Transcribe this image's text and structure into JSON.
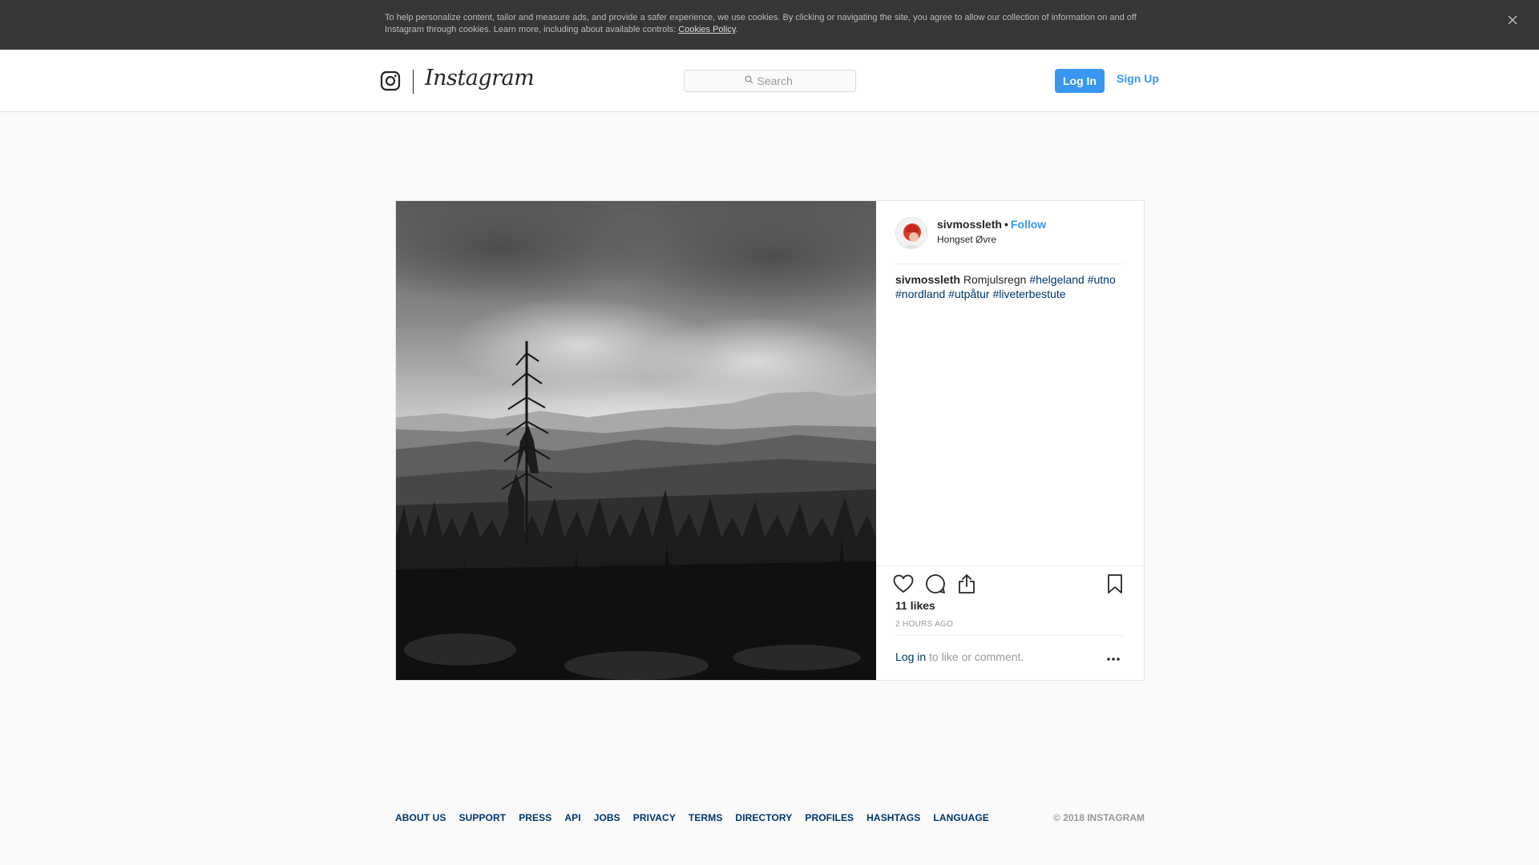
{
  "cookie_banner": {
    "text": "To help personalize content, tailor and measure ads, and provide a safer experience, we use cookies. By clicking or navigating the site, you agree to allow our collection of information on and off Instagram through cookies. Learn more, including about available controls: ",
    "link_label": "Cookies Policy",
    "suffix": ".",
    "close_icon": "close-icon"
  },
  "header": {
    "logo_icon": "instagram-glyph-icon",
    "wordmark": "Instagram",
    "search_placeholder": "Search",
    "login_label": "Log In",
    "signup_label": "Sign Up"
  },
  "post": {
    "username": "sivmossleth",
    "separator": "•",
    "follow_label": "Follow",
    "location": "Hongset Øvre",
    "caption": {
      "username": "sivmossleth",
      "text": "Romjulsregn",
      "hashtags": [
        "#helgeland",
        "#utno",
        "#nordland",
        "#utpåtur",
        "#liveterbestute"
      ]
    },
    "likes": "11 likes",
    "timestamp": "2 HOURS AGO",
    "login_link": "Log in",
    "login_suffix": " to like or comment.",
    "icons": {
      "like": "heart-icon",
      "comment": "comment-icon",
      "share": "share-icon",
      "save": "bookmark-icon",
      "more": "more-options-icon"
    },
    "colors": {
      "accent": "#3897f0",
      "link": "#003569",
      "muted": "#999999"
    }
  },
  "footer": {
    "links": [
      "ABOUT US",
      "SUPPORT",
      "PRESS",
      "API",
      "JOBS",
      "PRIVACY",
      "TERMS",
      "DIRECTORY",
      "PROFILES",
      "HASHTAGS",
      "LANGUAGE"
    ],
    "copyright": "© 2018 INSTAGRAM"
  }
}
